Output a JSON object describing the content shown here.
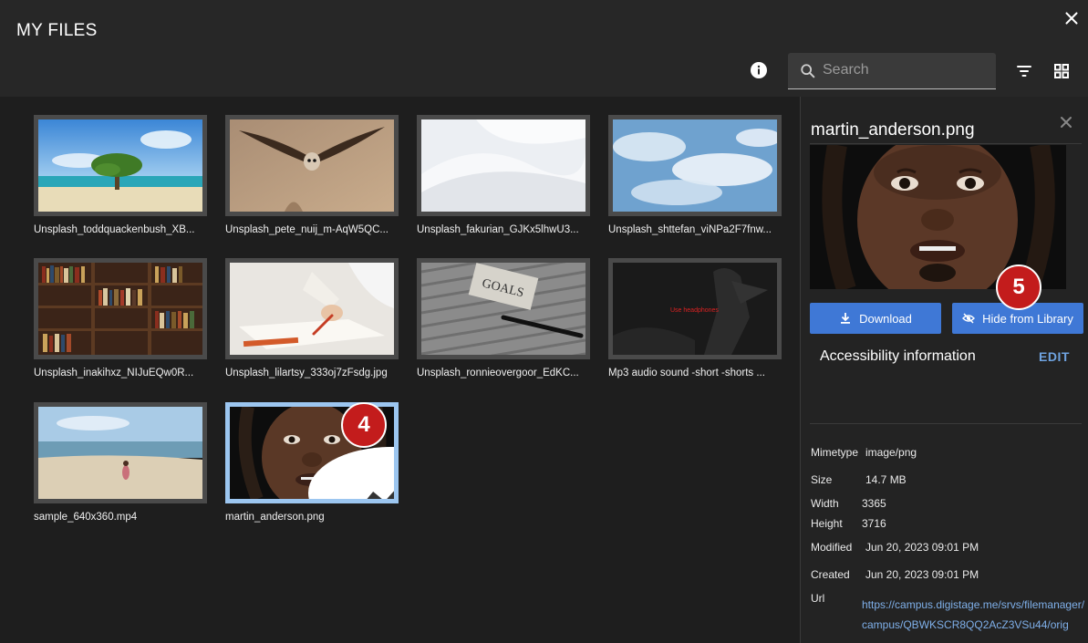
{
  "header": {
    "title": "MY FILES",
    "search_placeholder": "Search"
  },
  "files": [
    {
      "name": "Unsplash_toddquackenbush_XB..."
    },
    {
      "name": "Unsplash_pete_nuij_m-AqW5QC..."
    },
    {
      "name": "Unsplash_fakurian_GJKx5lhwU3..."
    },
    {
      "name": "Unsplash_shttefan_viNPa2F7fnw..."
    },
    {
      "name": "Unsplash_inakihxz_NIJuEQw0R..."
    },
    {
      "name": "Unsplash_lilartsy_333oj7zFsdg.jpg"
    },
    {
      "name": "Unsplash_ronnieovergoor_EdKC..."
    },
    {
      "name": "Mp3 audio sound -short -shorts ...",
      "overlay_text": "Use headphones"
    },
    {
      "name": "sample_640x360.mp4"
    },
    {
      "name": "martin_anderson.png",
      "selected": true
    }
  ],
  "thumb_overlays": {
    "goals_text": "GOALS"
  },
  "annotations": {
    "step4": "4",
    "step5": "5"
  },
  "details": {
    "filename": "martin_anderson.png",
    "download_label": "Download",
    "hide_label": "Hide from Library",
    "accessibility_label": "Accessibility information",
    "edit_label": "EDIT",
    "mimetype_label": "Mimetype",
    "mimetype": "image/png",
    "size_label": "Size",
    "size": "14.7 MB",
    "width_label": "Width",
    "width": "3365",
    "height_label": "Height",
    "height": "3716",
    "modified_label": "Modified",
    "modified": "Jun 20, 2023 09:01 PM",
    "created_label": "Created",
    "created": "Jun 20, 2023 09:01 PM",
    "url_label": "Url",
    "url": "https://campus.digistage.me/srvs/filemanager/campus/QBWKSCR8QQ2AcZ3VSu44/orig"
  },
  "colors": {
    "accent_button": "#3f78d6",
    "selected_border": "#9cc6f0",
    "step_badge": "#c31c1c",
    "link": "#7fb0ea"
  }
}
